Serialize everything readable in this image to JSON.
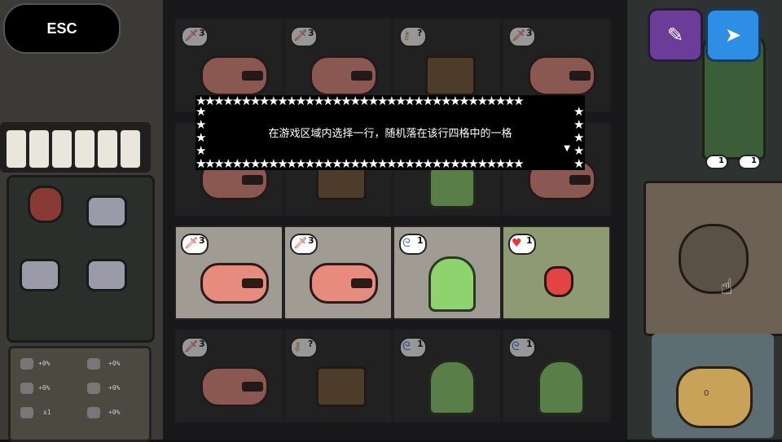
{
  "esc_label": "ESC",
  "dialog": {
    "message": "在游戏区域内选择一行，随机落在该行四格中的一格",
    "continue_icon": "triangle-down"
  },
  "buttons": {
    "edit_icon": "pencil-icon",
    "send_icon": "paper-plane-icon"
  },
  "stats": [
    {
      "icon": "sword-icon",
      "value": "+0%"
    },
    {
      "icon": "heart-icon",
      "value": "+0%"
    },
    {
      "icon": "cloud-icon",
      "value": "x1"
    },
    {
      "icon": "magnify-icon",
      "value": "+0%"
    },
    {
      "icon": "chest-icon",
      "value": "+0%"
    },
    {
      "icon": "spikes-icon",
      "value": "+0%"
    }
  ],
  "board_rows": [
    {
      "state": "dim",
      "cards": [
        {
          "type": "pig",
          "badge_icon": "sword",
          "badge": "3"
        },
        {
          "type": "pig",
          "badge_icon": "sword",
          "badge": "3"
        },
        {
          "type": "chest",
          "badge_icon": "key",
          "badge": "?"
        },
        {
          "type": "pig",
          "badge_icon": "sword",
          "badge": "3"
        }
      ]
    },
    {
      "state": "dim",
      "cards": [
        {
          "type": "pig",
          "badge_icon": "sword",
          "badge": ""
        },
        {
          "type": "chest",
          "badge_icon": "",
          "badge": ""
        },
        {
          "type": "slime",
          "badge_icon": "",
          "badge": ""
        },
        {
          "type": "pig",
          "badge_icon": "",
          "badge": ""
        }
      ]
    },
    {
      "state": "lit",
      "cards": [
        {
          "type": "pig",
          "badge_icon": "sword",
          "badge": "3"
        },
        {
          "type": "pig",
          "badge_icon": "sword",
          "badge": "3"
        },
        {
          "type": "slime",
          "badge_icon": "swirl",
          "badge": "1"
        },
        {
          "type": "strawberry",
          "badge_icon": "heart",
          "badge": "1"
        }
      ]
    },
    {
      "state": "dim",
      "cards": [
        {
          "type": "pig",
          "badge_icon": "sword",
          "badge": "3"
        },
        {
          "type": "chest",
          "badge_icon": "key",
          "badge": "?"
        },
        {
          "type": "slime",
          "badge_icon": "swirl",
          "badge": "1"
        },
        {
          "type": "slime",
          "badge_icon": "swirl",
          "badge": "1"
        }
      ]
    }
  ],
  "right_badges": [
    {
      "icon": "sword",
      "value": "1"
    },
    {
      "icon": "swirl",
      "value": "1"
    }
  ],
  "frog_value": "0"
}
